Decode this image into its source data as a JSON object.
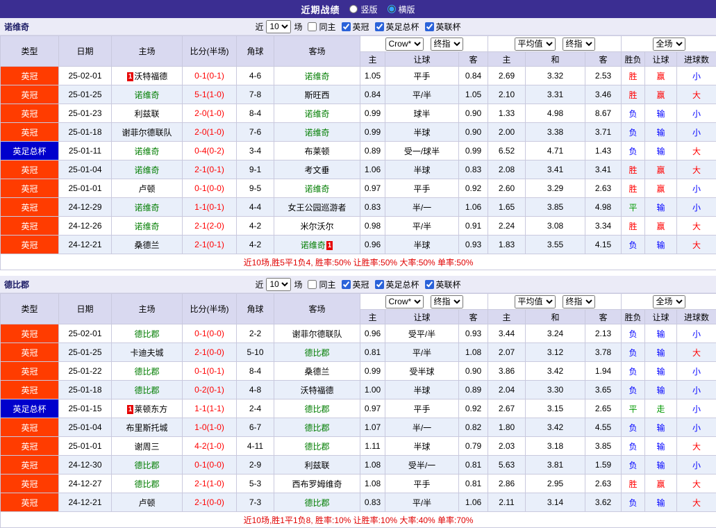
{
  "topbar": {
    "title": "近期战绩",
    "layout_options": [
      {
        "label": "竖版",
        "selected": false
      },
      {
        "label": "横版",
        "selected": true
      }
    ]
  },
  "colors": {
    "topbar_bg": "#3b2e92",
    "header_bg": "#d9d9f0",
    "alt_row_bg": "#e9effa",
    "focus_team": "#007d00",
    "score": "#ff0000",
    "summary": "#e00000"
  },
  "league_colors": {
    "英冠": "#ff3c00",
    "英足总杯": "#0000cc"
  },
  "result_color_map": {
    "胜": "#ff0000",
    "平": "#009900",
    "负": "#0000ff",
    "赢": "#ff0000",
    "走": "#009900",
    "输": "#0000ff",
    "大": "#ff0000",
    "小": "#0000ff"
  },
  "table_header": {
    "static": [
      "类型",
      "日期",
      "主场",
      "比分(半场)",
      "角球",
      "客场"
    ],
    "groups": [
      {
        "selects": [
          "Crow*",
          "终指"
        ],
        "cols": [
          "主",
          "让球",
          "客"
        ]
      },
      {
        "selects": [
          "平均值",
          "终指"
        ],
        "cols": [
          "主",
          "和",
          "客"
        ]
      },
      {
        "selects": [
          "全场"
        ],
        "cols": [
          "胜负",
          "让球",
          "进球数"
        ]
      }
    ]
  },
  "sections": [
    {
      "team": "诺维奇",
      "filters": {
        "prefix": "近",
        "count": "10",
        "suffix": "场",
        "options": [
          {
            "label": "同主",
            "checked": false
          },
          {
            "label": "英冠",
            "checked": true
          },
          {
            "label": "英足总杯",
            "checked": true
          },
          {
            "label": "英联杯",
            "checked": true
          }
        ]
      },
      "rows": [
        {
          "league": "英冠",
          "date": "25-02-01",
          "home": {
            "name": "沃特福德",
            "focus": false,
            "badge_before": "1"
          },
          "score": "0-1(0-1)",
          "corners": "4-6",
          "away": {
            "name": "诺维奇",
            "focus": true
          },
          "odds": [
            "1.05",
            "平手",
            "0.84"
          ],
          "avg": [
            "2.69",
            "3.32",
            "2.53"
          ],
          "result": [
            "胜",
            "赢",
            "小"
          ]
        },
        {
          "league": "英冠",
          "date": "25-01-25",
          "home": {
            "name": "诺维奇",
            "focus": true
          },
          "score": "5-1(1-0)",
          "corners": "7-8",
          "away": {
            "name": "斯旺西",
            "focus": false
          },
          "odds": [
            "0.84",
            "平/半",
            "1.05"
          ],
          "avg": [
            "2.10",
            "3.31",
            "3.46"
          ],
          "result": [
            "胜",
            "赢",
            "大"
          ]
        },
        {
          "league": "英冠",
          "date": "25-01-23",
          "home": {
            "name": "利兹联",
            "focus": false
          },
          "score": "2-0(1-0)",
          "corners": "8-4",
          "away": {
            "name": "诺维奇",
            "focus": true
          },
          "odds": [
            "0.99",
            "球半",
            "0.90"
          ],
          "avg": [
            "1.33",
            "4.98",
            "8.67"
          ],
          "result": [
            "负",
            "输",
            "小"
          ]
        },
        {
          "league": "英冠",
          "date": "25-01-18",
          "home": {
            "name": "谢菲尔德联队",
            "focus": false
          },
          "score": "2-0(1-0)",
          "corners": "7-6",
          "away": {
            "name": "诺维奇",
            "focus": true
          },
          "odds": [
            "0.99",
            "半球",
            "0.90"
          ],
          "avg": [
            "2.00",
            "3.38",
            "3.71"
          ],
          "result": [
            "负",
            "输",
            "小"
          ]
        },
        {
          "league": "英足总杯",
          "date": "25-01-11",
          "home": {
            "name": "诺维奇",
            "focus": true
          },
          "score": "0-4(0-2)",
          "corners": "3-4",
          "away": {
            "name": "布莱顿",
            "focus": false
          },
          "odds": [
            "0.89",
            "受一/球半",
            "0.99"
          ],
          "avg": [
            "6.52",
            "4.71",
            "1.43"
          ],
          "result": [
            "负",
            "输",
            "大"
          ]
        },
        {
          "league": "英冠",
          "date": "25-01-04",
          "home": {
            "name": "诺维奇",
            "focus": true
          },
          "score": "2-1(0-1)",
          "corners": "9-1",
          "away": {
            "name": "考文垂",
            "focus": false
          },
          "odds": [
            "1.06",
            "半球",
            "0.83"
          ],
          "avg": [
            "2.08",
            "3.41",
            "3.41"
          ],
          "result": [
            "胜",
            "赢",
            "大"
          ]
        },
        {
          "league": "英冠",
          "date": "25-01-01",
          "home": {
            "name": "卢顿",
            "focus": false
          },
          "score": "0-1(0-0)",
          "corners": "9-5",
          "away": {
            "name": "诺维奇",
            "focus": true
          },
          "odds": [
            "0.97",
            "平手",
            "0.92"
          ],
          "avg": [
            "2.60",
            "3.29",
            "2.63"
          ],
          "result": [
            "胜",
            "赢",
            "小"
          ]
        },
        {
          "league": "英冠",
          "date": "24-12-29",
          "home": {
            "name": "诺维奇",
            "focus": true
          },
          "score": "1-1(0-1)",
          "corners": "4-4",
          "away": {
            "name": "女王公园巡游者",
            "focus": false
          },
          "odds": [
            "0.83",
            "半/一",
            "1.06"
          ],
          "avg": [
            "1.65",
            "3.85",
            "4.98"
          ],
          "result": [
            "平",
            "输",
            "小"
          ]
        },
        {
          "league": "英冠",
          "date": "24-12-26",
          "home": {
            "name": "诺维奇",
            "focus": true
          },
          "score": "2-1(2-0)",
          "corners": "4-2",
          "away": {
            "name": "米尔沃尔",
            "focus": false
          },
          "odds": [
            "0.98",
            "平/半",
            "0.91"
          ],
          "avg": [
            "2.24",
            "3.08",
            "3.34"
          ],
          "result": [
            "胜",
            "赢",
            "大"
          ]
        },
        {
          "league": "英冠",
          "date": "24-12-21",
          "home": {
            "name": "桑德兰",
            "focus": false
          },
          "score": "2-1(0-1)",
          "corners": "4-2",
          "away": {
            "name": "诺维奇",
            "focus": true,
            "badge_after": "1"
          },
          "odds": [
            "0.96",
            "半球",
            "0.93"
          ],
          "avg": [
            "1.83",
            "3.55",
            "4.15"
          ],
          "result": [
            "负",
            "输",
            "大"
          ]
        }
      ],
      "summary": "近10场,胜5平1负4, 胜率:50% 让胜率:50% 大率:50% 单率:50%"
    },
    {
      "team": "德比郡",
      "filters": {
        "prefix": "近",
        "count": "10",
        "suffix": "场",
        "options": [
          {
            "label": "同主",
            "checked": false
          },
          {
            "label": "英冠",
            "checked": true
          },
          {
            "label": "英足总杯",
            "checked": true
          },
          {
            "label": "英联杯",
            "checked": true
          }
        ]
      },
      "rows": [
        {
          "league": "英冠",
          "date": "25-02-01",
          "home": {
            "name": "德比郡",
            "focus": true
          },
          "score": "0-1(0-0)",
          "corners": "2-2",
          "away": {
            "name": "谢菲尔德联队",
            "focus": false
          },
          "odds": [
            "0.96",
            "受平/半",
            "0.93"
          ],
          "avg": [
            "3.44",
            "3.24",
            "2.13"
          ],
          "result": [
            "负",
            "输",
            "小"
          ]
        },
        {
          "league": "英冠",
          "date": "25-01-25",
          "home": {
            "name": "卡迪夫城",
            "focus": false
          },
          "score": "2-1(0-0)",
          "corners": "5-10",
          "away": {
            "name": "德比郡",
            "focus": true
          },
          "odds": [
            "0.81",
            "平/半",
            "1.08"
          ],
          "avg": [
            "2.07",
            "3.12",
            "3.78"
          ],
          "result": [
            "负",
            "输",
            "大"
          ]
        },
        {
          "league": "英冠",
          "date": "25-01-22",
          "home": {
            "name": "德比郡",
            "focus": true
          },
          "score": "0-1(0-1)",
          "corners": "8-4",
          "away": {
            "name": "桑德兰",
            "focus": false
          },
          "odds": [
            "0.99",
            "受半球",
            "0.90"
          ],
          "avg": [
            "3.86",
            "3.42",
            "1.94"
          ],
          "result": [
            "负",
            "输",
            "小"
          ]
        },
        {
          "league": "英冠",
          "date": "25-01-18",
          "home": {
            "name": "德比郡",
            "focus": true
          },
          "score": "0-2(0-1)",
          "corners": "4-8",
          "away": {
            "name": "沃特福德",
            "focus": false
          },
          "odds": [
            "1.00",
            "半球",
            "0.89"
          ],
          "avg": [
            "2.04",
            "3.30",
            "3.65"
          ],
          "result": [
            "负",
            "输",
            "小"
          ]
        },
        {
          "league": "英足总杯",
          "date": "25-01-15",
          "home": {
            "name": "莱顿东方",
            "focus": false,
            "badge_before": "1"
          },
          "score": "1-1(1-1)",
          "corners": "2-4",
          "away": {
            "name": "德比郡",
            "focus": true
          },
          "odds": [
            "0.97",
            "平手",
            "0.92"
          ],
          "avg": [
            "2.67",
            "3.15",
            "2.65"
          ],
          "result": [
            "平",
            "走",
            "小"
          ]
        },
        {
          "league": "英冠",
          "date": "25-01-04",
          "home": {
            "name": "布里斯托城",
            "focus": false
          },
          "score": "1-0(1-0)",
          "corners": "6-7",
          "away": {
            "name": "德比郡",
            "focus": true
          },
          "odds": [
            "1.07",
            "半/一",
            "0.82"
          ],
          "avg": [
            "1.80",
            "3.42",
            "4.55"
          ],
          "result": [
            "负",
            "输",
            "小"
          ]
        },
        {
          "league": "英冠",
          "date": "25-01-01",
          "home": {
            "name": "谢周三",
            "focus": false
          },
          "score": "4-2(1-0)",
          "corners": "4-11",
          "away": {
            "name": "德比郡",
            "focus": true
          },
          "odds": [
            "1.11",
            "半球",
            "0.79"
          ],
          "avg": [
            "2.03",
            "3.18",
            "3.85"
          ],
          "result": [
            "负",
            "输",
            "大"
          ]
        },
        {
          "league": "英冠",
          "date": "24-12-30",
          "home": {
            "name": "德比郡",
            "focus": true
          },
          "score": "0-1(0-0)",
          "corners": "2-9",
          "away": {
            "name": "利兹联",
            "focus": false
          },
          "odds": [
            "1.08",
            "受半/一",
            "0.81"
          ],
          "avg": [
            "5.63",
            "3.81",
            "1.59"
          ],
          "result": [
            "负",
            "输",
            "小"
          ]
        },
        {
          "league": "英冠",
          "date": "24-12-27",
          "home": {
            "name": "德比郡",
            "focus": true
          },
          "score": "2-1(1-0)",
          "corners": "5-3",
          "away": {
            "name": "西布罗姆维奇",
            "focus": false
          },
          "odds": [
            "1.08",
            "平手",
            "0.81"
          ],
          "avg": [
            "2.86",
            "2.95",
            "2.63"
          ],
          "result": [
            "胜",
            "赢",
            "大"
          ]
        },
        {
          "league": "英冠",
          "date": "24-12-21",
          "home": {
            "name": "卢顿",
            "focus": false
          },
          "score": "2-1(0-0)",
          "corners": "7-3",
          "away": {
            "name": "德比郡",
            "focus": true
          },
          "odds": [
            "0.83",
            "平/半",
            "1.06"
          ],
          "avg": [
            "2.11",
            "3.14",
            "3.62"
          ],
          "result": [
            "负",
            "输",
            "大"
          ]
        }
      ],
      "summary": "近10场,胜1平1负8, 胜率:10% 让胜率:10% 大率:40% 单率:70%"
    }
  ]
}
